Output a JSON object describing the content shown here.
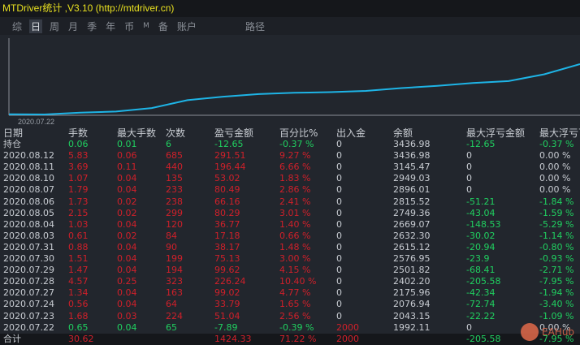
{
  "title": "MTDriver统计 ,V3.10 (http://mtdriver.cn)",
  "tabs": [
    "综",
    "日",
    "周",
    "月",
    "季",
    "年",
    "币",
    "M",
    "备",
    "账户"
  ],
  "active_tab": 1,
  "path_label": "路径",
  "chart": {
    "x_label": "2020.07.22",
    "line_color": "#1eb4e6"
  },
  "columns": [
    "日期",
    "手数",
    "最大手数",
    "次数",
    "盈亏金额",
    "百分比%",
    "出入金",
    "余额",
    "最大浮亏金额",
    "最大浮亏百"
  ],
  "holding": {
    "date": "持仓",
    "lots": "0.06",
    "max_lots": "0.01",
    "count": "6",
    "pnl": "-12.65",
    "pct": "-0.37 %",
    "flow": "0",
    "balance": "3436.98",
    "max_dd": "-12.65",
    "max_dd_pct": "-0.37 %"
  },
  "rows": [
    {
      "date": "2020.08.12",
      "lots": "5.83",
      "max_lots": "0.06",
      "count": "685",
      "pnl": "291.51",
      "pct": "9.27 %",
      "flow": "0",
      "balance": "3436.98",
      "max_dd": "0",
      "max_dd_pct": "0.00 %",
      "win": true
    },
    {
      "date": "2020.08.11",
      "lots": "3.69",
      "max_lots": "0.11",
      "count": "440",
      "pnl": "196.44",
      "pct": "6.66 %",
      "flow": "0",
      "balance": "3145.47",
      "max_dd": "0",
      "max_dd_pct": "0.00 %",
      "win": true
    },
    {
      "date": "2020.08.10",
      "lots": "1.07",
      "max_lots": "0.04",
      "count": "135",
      "pnl": "53.02",
      "pct": "1.83 %",
      "flow": "0",
      "balance": "2949.03",
      "max_dd": "0",
      "max_dd_pct": "0.00 %",
      "win": true
    },
    {
      "date": "2020.08.07",
      "lots": "1.79",
      "max_lots": "0.04",
      "count": "233",
      "pnl": "80.49",
      "pct": "2.86 %",
      "flow": "0",
      "balance": "2896.01",
      "max_dd": "0",
      "max_dd_pct": "0.00 %",
      "win": true
    },
    {
      "date": "2020.08.06",
      "lots": "1.73",
      "max_lots": "0.02",
      "count": "238",
      "pnl": "66.16",
      "pct": "2.41 %",
      "flow": "0",
      "balance": "2815.52",
      "max_dd": "-51.21",
      "max_dd_pct": "-1.84 %",
      "win": true
    },
    {
      "date": "2020.08.05",
      "lots": "2.15",
      "max_lots": "0.02",
      "count": "299",
      "pnl": "80.29",
      "pct": "3.01 %",
      "flow": "0",
      "balance": "2749.36",
      "max_dd": "-43.04",
      "max_dd_pct": "-1.59 %",
      "win": true
    },
    {
      "date": "2020.08.04",
      "lots": "1.03",
      "max_lots": "0.04",
      "count": "120",
      "pnl": "36.77",
      "pct": "1.40 %",
      "flow": "0",
      "balance": "2669.07",
      "max_dd": "-148.53",
      "max_dd_pct": "-5.29 %",
      "win": true
    },
    {
      "date": "2020.08.03",
      "lots": "0.61",
      "max_lots": "0.02",
      "count": "84",
      "pnl": "17.18",
      "pct": "0.66 %",
      "flow": "0",
      "balance": "2632.30",
      "max_dd": "-30.02",
      "max_dd_pct": "-1.14 %",
      "win": true
    },
    {
      "date": "2020.07.31",
      "lots": "0.88",
      "max_lots": "0.04",
      "count": "90",
      "pnl": "38.17",
      "pct": "1.48 %",
      "flow": "0",
      "balance": "2615.12",
      "max_dd": "-20.94",
      "max_dd_pct": "-0.80 %",
      "win": true
    },
    {
      "date": "2020.07.30",
      "lots": "1.51",
      "max_lots": "0.04",
      "count": "199",
      "pnl": "75.13",
      "pct": "3.00 %",
      "flow": "0",
      "balance": "2576.95",
      "max_dd": "-23.9",
      "max_dd_pct": "-0.93 %",
      "win": true
    },
    {
      "date": "2020.07.29",
      "lots": "1.47",
      "max_lots": "0.04",
      "count": "194",
      "pnl": "99.62",
      "pct": "4.15 %",
      "flow": "0",
      "balance": "2501.82",
      "max_dd": "-68.41",
      "max_dd_pct": "-2.71 %",
      "win": true
    },
    {
      "date": "2020.07.28",
      "lots": "4.57",
      "max_lots": "0.25",
      "count": "323",
      "pnl": "226.24",
      "pct": "10.40 %",
      "flow": "0",
      "balance": "2402.20",
      "max_dd": "-205.58",
      "max_dd_pct": "-7.95 %",
      "win": true
    },
    {
      "date": "2020.07.27",
      "lots": "1.34",
      "max_lots": "0.04",
      "count": "163",
      "pnl": "99.02",
      "pct": "4.77 %",
      "flow": "0",
      "balance": "2175.96",
      "max_dd": "-42.34",
      "max_dd_pct": "-1.94 %",
      "win": true
    },
    {
      "date": "2020.07.24",
      "lots": "0.56",
      "max_lots": "0.04",
      "count": "64",
      "pnl": "33.79",
      "pct": "1.65 %",
      "flow": "0",
      "balance": "2076.94",
      "max_dd": "-72.74",
      "max_dd_pct": "-3.40 %",
      "win": true
    },
    {
      "date": "2020.07.23",
      "lots": "1.68",
      "max_lots": "0.03",
      "count": "224",
      "pnl": "51.04",
      "pct": "2.56 %",
      "flow": "0",
      "balance": "2043.15",
      "max_dd": "-22.22",
      "max_dd_pct": "-1.09 %",
      "win": true
    },
    {
      "date": "2020.07.22",
      "lots": "0.65",
      "max_lots": "0.04",
      "count": "65",
      "pnl": "-7.89",
      "pct": "-0.39 %",
      "flow": "2000",
      "balance": "1992.11",
      "max_dd": "0",
      "max_dd_pct": "0.00 %",
      "win": false
    }
  ],
  "total": {
    "date": "合计",
    "lots": "30.62",
    "max_lots": "",
    "count": "",
    "pnl": "1424.33",
    "pct": "71.22 %",
    "flow": "2000",
    "balance": "",
    "max_dd": "-205.58",
    "max_dd_pct": "-7.95 %"
  },
  "watermark": "EAHub"
}
